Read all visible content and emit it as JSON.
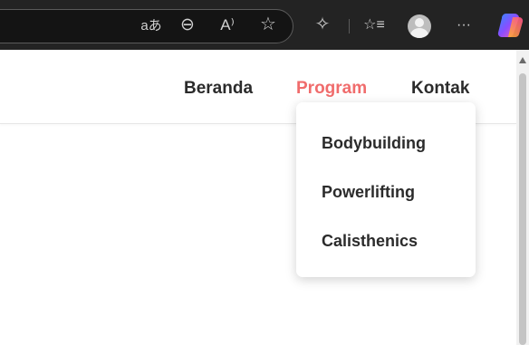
{
  "browser": {
    "icons": {
      "translate": "aあ",
      "zoom": "⊖",
      "read_aloud": "A⁾",
      "favorite": "☆",
      "extensions": "✧",
      "favorites_list": "☆≡",
      "more": "···"
    }
  },
  "nav": {
    "items": [
      {
        "label": "Beranda"
      },
      {
        "label": "Program"
      },
      {
        "label": "Kontak"
      }
    ]
  },
  "dropdown": {
    "items": [
      {
        "label": "Bodybuilding"
      },
      {
        "label": "Powerlifting"
      },
      {
        "label": "Calisthenics"
      }
    ]
  },
  "colors": {
    "accent": "#f06c6c",
    "text": "#2b2b2b"
  }
}
